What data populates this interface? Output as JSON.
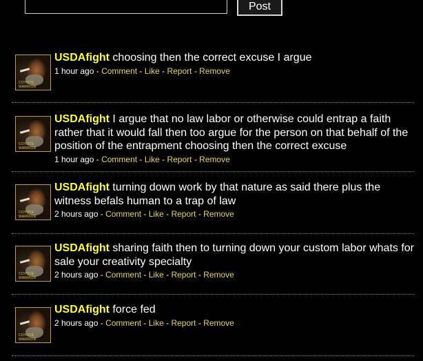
{
  "composer": {
    "input_value": "",
    "post_label": "Post"
  },
  "avatar_caption": "COYOTE WARRIOR",
  "separator": " - ",
  "posts": [
    {
      "user": "USDAfight",
      "text": " choosing then the correct excuse I argue",
      "time": "1 hour ago",
      "actions": {
        "comment": "Comment",
        "like": "Like",
        "report": "Report",
        "remove": "Remove"
      }
    },
    {
      "user": "USDAfight",
      "text": " I argue that no law labor or otherwise could entrap a faith rather that it would fall then too argue for the person on that behalf of the position of the entrapment choosing then the correct excuse",
      "time": "1 hour ago",
      "actions": {
        "comment": "Comment",
        "like": "Like",
        "report": "Report",
        "remove": "Remove"
      }
    },
    {
      "user": "USDAfight",
      "text": " turning down work by that nature as said there plus the witness befals human to a trap of law",
      "time": "2 hours ago",
      "actions": {
        "comment": "Comment",
        "like": "Like",
        "report": "Report",
        "remove": "Remove"
      }
    },
    {
      "user": "USDAfight",
      "text": " sharing faith then to turning down your custom labor whats for sale your creativity specialty",
      "time": "2 hours ago",
      "actions": {
        "comment": "Comment",
        "like": "Like",
        "report": "Report",
        "remove": "Remove"
      }
    },
    {
      "user": "USDAfight",
      "text": " force fed",
      "time": "2 hours ago",
      "actions": {
        "comment": "Comment",
        "like": "Like",
        "report": "Report",
        "remove": "Remove"
      }
    }
  ],
  "colors": {
    "background": "#000000",
    "username": "#ffff33",
    "link": "#e7d84a",
    "text": "#ffffff"
  }
}
